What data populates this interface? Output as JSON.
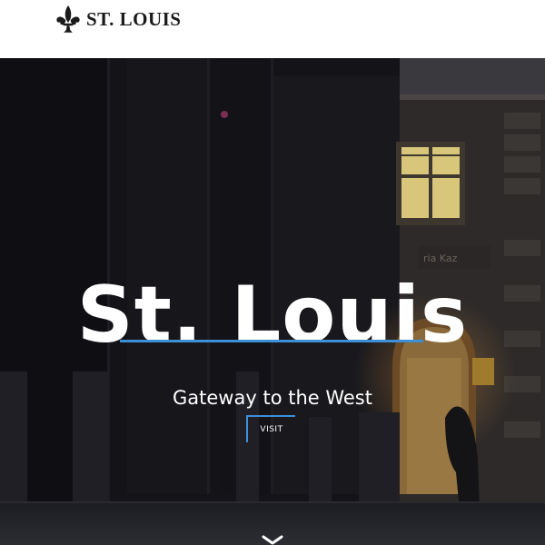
{
  "header": {
    "logo_icon": "fleur-de-lis-icon",
    "logo_text": "ST. LOUIS"
  },
  "hero": {
    "title": "St. Louis",
    "subtitle": "Gateway to the West",
    "cta_label": "VISIT",
    "scroll_icon": "chevron-down-icon"
  },
  "colors": {
    "accent": "#3d8fd6",
    "header_bg": "#ffffff",
    "hero_text": "#ffffff",
    "logo_text": "#1a1a1a"
  }
}
